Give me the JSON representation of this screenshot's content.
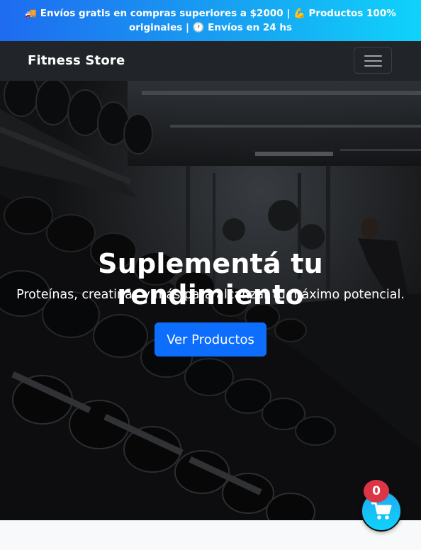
{
  "promo": {
    "text": "🚚 Envíos gratis en compras superiores a $2000 | 💪 Productos 100% originales | 🕐 Envíos en 24 hs"
  },
  "navbar": {
    "brand": "Fitness Store",
    "toggler_icon": "hamburger-icon"
  },
  "hero": {
    "title": "Suplementá tu rendimiento",
    "subtitle": "Proteínas, creatinas y más para alcanzar tu máximo potencial.",
    "cta_label": "Ver Productos",
    "background": "gym-dumbbell-rack-photo"
  },
  "cart": {
    "icon": "cart-icon",
    "count": "0"
  },
  "colors": {
    "promo_gradient_start": "#1e6bf0",
    "promo_gradient_end": "#0fd3fb",
    "navbar": "#212529",
    "cta": "#0d6efd",
    "badge": "#dc3545"
  }
}
